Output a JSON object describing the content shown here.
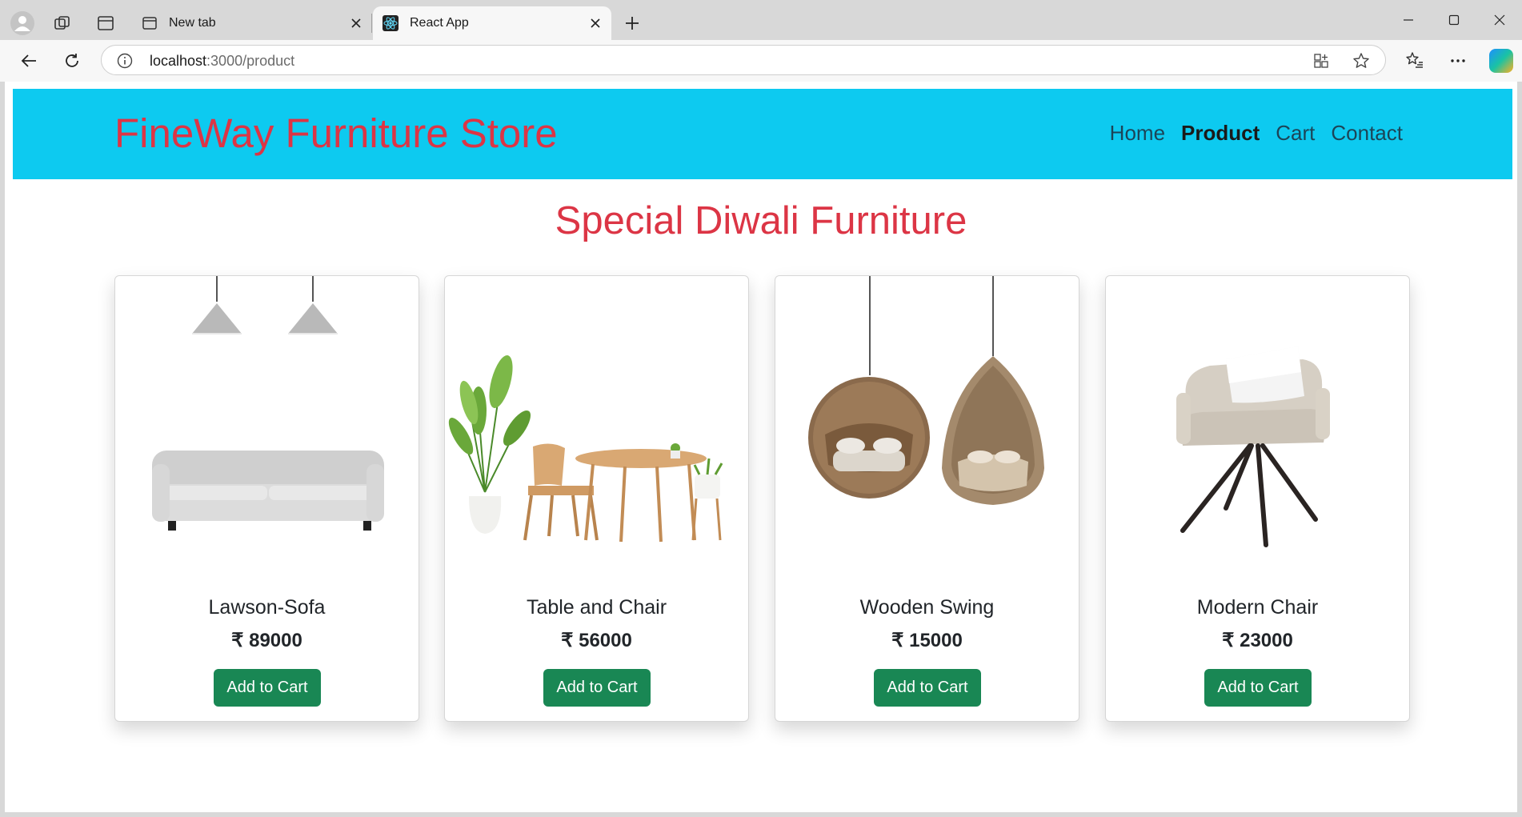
{
  "browser": {
    "tabs": [
      {
        "title": "New tab",
        "favicon": "new-tab-icon",
        "active": false
      },
      {
        "title": "React App",
        "favicon": "react-icon",
        "active": true
      }
    ],
    "address": {
      "host": "localhost",
      "path": ":3000/product"
    }
  },
  "site": {
    "brand": "FineWay Furniture Store",
    "nav": {
      "home": "Home",
      "product": "Product",
      "cart": "Cart",
      "contact": "Contact"
    },
    "active_nav": "Product",
    "heading": "Special Diwali Furniture"
  },
  "products": [
    {
      "name": "Lawson-Sofa",
      "price": "₹ 89000",
      "button": "Add to Cart",
      "image": "sofa-with-pendant-lamps"
    },
    {
      "name": "Table and Chair",
      "price": "₹ 56000",
      "button": "Add to Cart",
      "image": "table-chair-and-plants"
    },
    {
      "name": "Wooden Swing",
      "price": "₹ 15000",
      "button": "Add to Cart",
      "image": "hanging-rattan-swing-chairs"
    },
    {
      "name": "Modern Chair",
      "price": "₹ 23000",
      "button": "Add to Cart",
      "image": "beige-armchair-with-pillow"
    }
  ],
  "colors": {
    "header_bg": "#0dcaf0",
    "brand_red": "#dc3545",
    "button_green": "#198754"
  }
}
